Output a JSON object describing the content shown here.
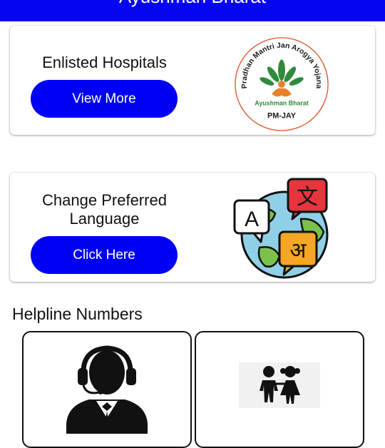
{
  "header": {
    "title": "Ayushman Bharat"
  },
  "cards": [
    {
      "title": "Enlisted Hospitals",
      "button_label": "View More",
      "logo": {
        "icon": "pmjay-logo",
        "ring_text": "Pradhan Mantri Jan Arogya Yojana",
        "name": "Ayushman Bharat",
        "short": "PM-JAY"
      }
    },
    {
      "title": "Change Preferred Language",
      "button_label": "Click Here",
      "icon": "language-globe-icon",
      "glyphs": {
        "latin": "A",
        "hindi1": "文",
        "hindi2": "अ"
      }
    }
  ],
  "helpline": {
    "title": "Helpline Numbers",
    "tiles": [
      {
        "icon": "call-center-agent-icon"
      },
      {
        "icon": "children-icon"
      }
    ]
  },
  "colors": {
    "header": "#0505f3",
    "button": "#0000f5",
    "logo_ring": "#e0623a",
    "logo_leaf": "#2e8b3a"
  }
}
